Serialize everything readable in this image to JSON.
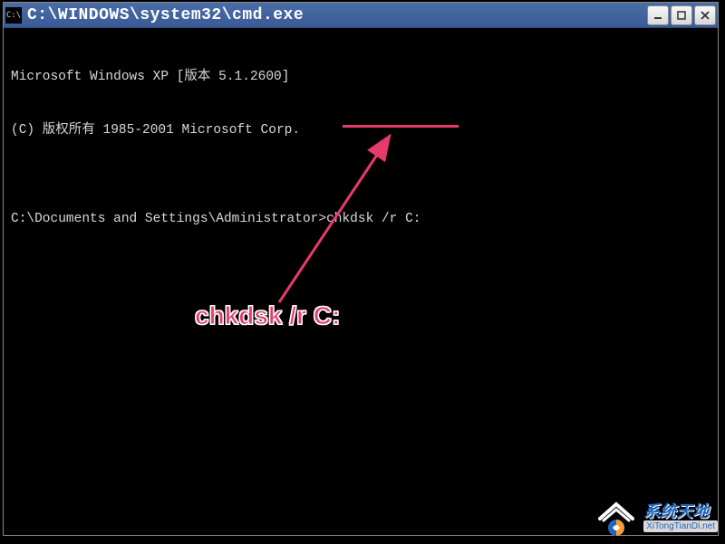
{
  "window": {
    "icon_label": "C:\\",
    "title": "C:\\WINDOWS\\system32\\cmd.exe",
    "controls": {
      "minimize": "minimize",
      "maximize": "maximize",
      "close": "close"
    }
  },
  "terminal": {
    "line1": "Microsoft Windows XP [版本 5.1.2600]",
    "line2": "(C) 版权所有 1985-2001 Microsoft Corp.",
    "blank": "",
    "prompt": "C:\\Documents and Settings\\Administrator>",
    "command": "chkdsk /r C:"
  },
  "annotation": {
    "label": "chkdsk /r C:",
    "color": "#e83a6a"
  },
  "watermark": {
    "name_cn": "系统天地",
    "name_en": "XiTongTianDi.net"
  }
}
